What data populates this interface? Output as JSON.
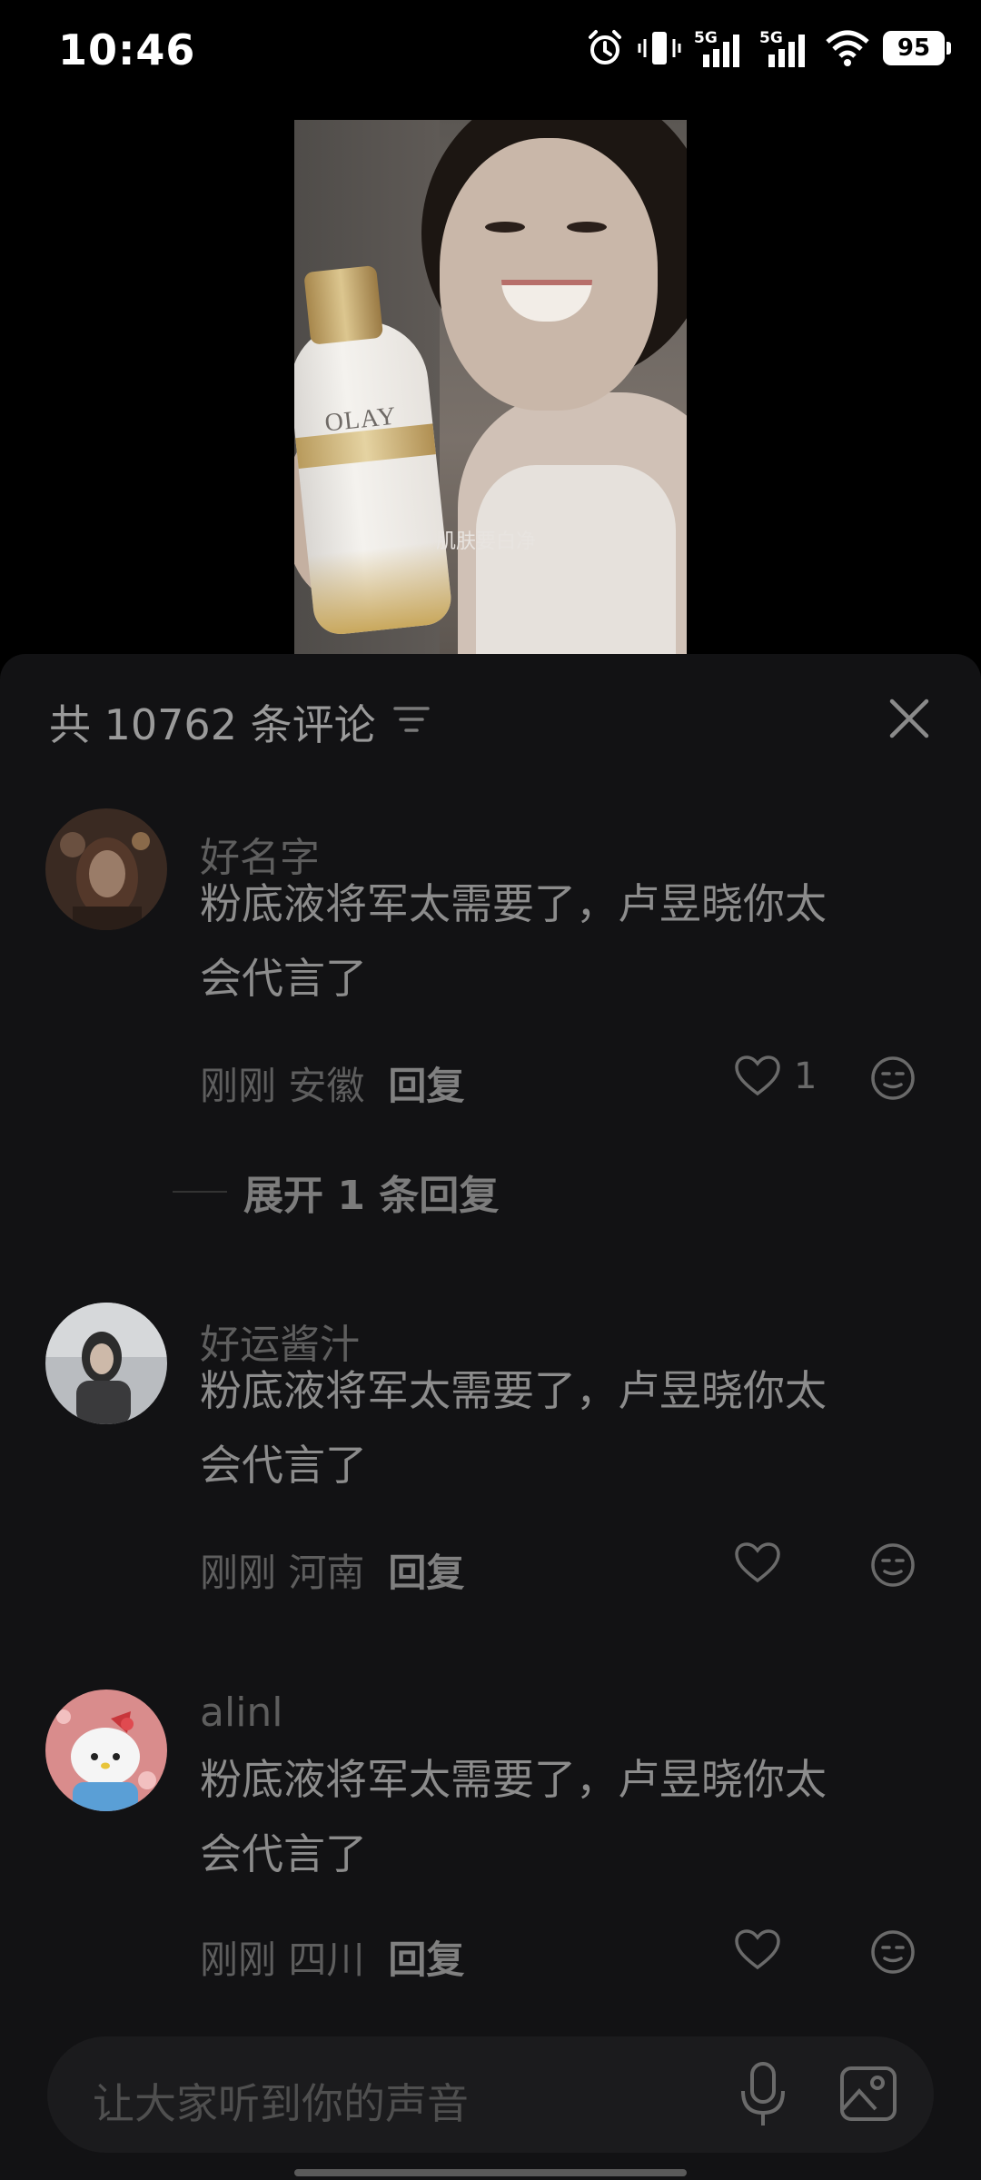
{
  "status_bar": {
    "time": "10:46",
    "battery": "95",
    "network_1": "5G",
    "network_2": "5G"
  },
  "video": {
    "brand": "OLAY",
    "caption": "肌肤要白净"
  },
  "comments_panel": {
    "count_title": "共 10762 条评论",
    "comments": [
      {
        "username": "好名字",
        "text_line1": "粉底液将军太需要了，卢昱晓你太",
        "text_line2": "会代言了",
        "time_location": "刚刚 安徽",
        "reply_label": "回复",
        "likes": "1",
        "expand_label": "展开 1 条回复"
      },
      {
        "username": "好运酱汁",
        "text_line1": "粉底液将军太需要了，卢昱晓你太",
        "text_line2": "会代言了",
        "time_location": "刚刚 河南",
        "reply_label": "回复"
      },
      {
        "username": "alinl",
        "text_line1": "粉底液将军太需要了，卢昱晓你太",
        "text_line2": "会代言了",
        "time_location": "刚刚 四川",
        "reply_label": "回复"
      }
    ]
  },
  "input": {
    "placeholder": "让大家听到你的声音"
  }
}
